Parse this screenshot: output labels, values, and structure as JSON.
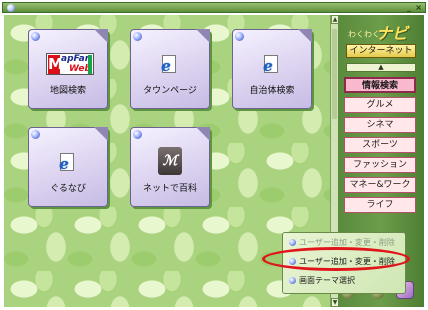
{
  "window": {
    "min_glyph": "_",
    "close_glyph": "×"
  },
  "tiles": [
    {
      "id": "map",
      "label": "地図検索",
      "logo_text": "apFan",
      "logo_sub": "Web",
      "logo_m": "M"
    },
    {
      "id": "townpage",
      "label": "タウンページ",
      "icon_glyph": "e"
    },
    {
      "id": "gov",
      "label": "自治体検索",
      "icon_glyph": "e"
    },
    {
      "id": "gurunavi",
      "label": "ぐるなび",
      "icon_glyph": "e"
    },
    {
      "id": "encyclopedia",
      "label": "ネットで百科",
      "icon_glyph": "ℳ"
    }
  ],
  "scrollbar": {
    "up": "▲",
    "down": "▼"
  },
  "sidebar": {
    "logo_sub": "わくわく",
    "logo_main": "ナビ",
    "internet_label": "インターネット",
    "up_arrow": "▲",
    "categories": [
      {
        "label": "情報検索",
        "selected": true
      },
      {
        "label": "グルメ",
        "selected": false
      },
      {
        "label": "シネマ",
        "selected": false
      },
      {
        "label": "スポーツ",
        "selected": false
      },
      {
        "label": "ファッション",
        "selected": false
      },
      {
        "label": "マネー&ワーク",
        "selected": false
      },
      {
        "label": "ライフ",
        "selected": false
      }
    ]
  },
  "popup": {
    "items": [
      {
        "label": "ユーザー追加・変更・削除",
        "faded": true
      },
      {
        "label": "ユーザー追加・変更・削除",
        "faded": false
      },
      {
        "label": "画面テーマ選択",
        "faded": false
      }
    ],
    "highlight_color": "#e0151b"
  }
}
